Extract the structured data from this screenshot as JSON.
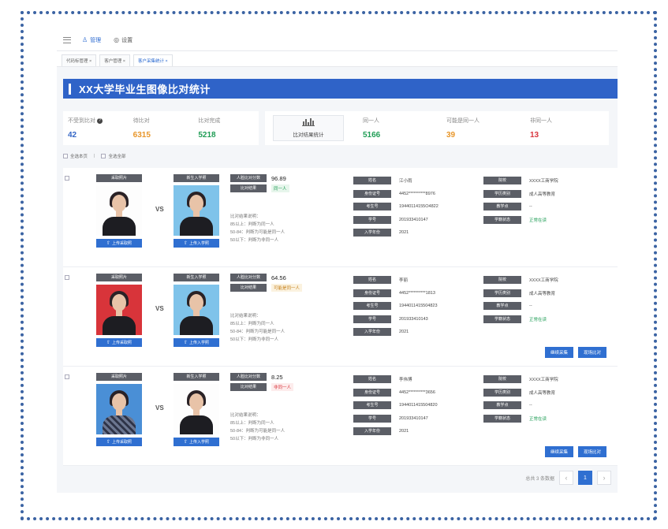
{
  "nav": {
    "items": [
      {
        "icon": "♙",
        "label": "管理",
        "active": true
      },
      {
        "icon": "◎",
        "label": "设置",
        "active": false
      }
    ]
  },
  "tabs": [
    "代码标管理 ×",
    "客户管理 ×",
    "客户采集统计 ×"
  ],
  "page_title": "XX大学毕业生图像比对统计",
  "stats_left": [
    {
      "label": "不受到比对",
      "value": "42",
      "color": "blue",
      "help": true
    },
    {
      "label": "待比对",
      "value": "6315",
      "color": "orange"
    },
    {
      "label": "比对完成",
      "value": "5218",
      "color": "green"
    }
  ],
  "result_button": "比对结果统计",
  "stats_right": [
    {
      "label": "同一人",
      "value": "5166",
      "color": "green"
    },
    {
      "label": "可能是同一人",
      "value": "39",
      "color": "orange"
    },
    {
      "label": "非同一人",
      "value": "13",
      "color": "red"
    }
  ],
  "select_bar": {
    "current_page": "全选本页",
    "all": "全选全部"
  },
  "labels": {
    "collect_photo": "采取照片",
    "enroll_photo": "新生入学照",
    "upload_collect": "上传采取照",
    "upload_enroll": "上传入学照",
    "vs": "VS",
    "score": "人脸比对分数",
    "result": "比对结果",
    "rules_title": "比对结果说明：",
    "rule1": "85以上：判断为同一人",
    "rule2": "50-84：判断为可能是同一人",
    "rule3": "50以下：判断为非同一人",
    "name": "姓名",
    "id_no": "身份证号",
    "exam_no": "考生号",
    "student_no": "学号",
    "year": "入学年份",
    "school": "院校",
    "edu_type": "学历类别",
    "teach_point": "教学点",
    "status": "学籍状态",
    "btn_recollect": "继续采集",
    "btn_compare": "现场比对"
  },
  "records": [
    {
      "score": "96.89",
      "result": "同一人",
      "result_color": "green",
      "name": "江小雨",
      "id_no": "4452**********8976",
      "exam_no": "19440114155O4822",
      "student_no": "201933410147",
      "year": "2021",
      "school": "XXXX工商学院",
      "edu_type": "成人高等教育",
      "teach_point": "--",
      "status": "正常在读",
      "status_color": "green",
      "show_actions": false
    },
    {
      "score": "64.56",
      "result": "可能是同一人",
      "result_color": "orange",
      "name": "李丽",
      "id_no": "4452**********1813",
      "exam_no": "1944011415504823",
      "student_no": "201933410143",
      "year": "2021",
      "school": "XXXX工商学院",
      "edu_type": "成人高等教育",
      "teach_point": "--",
      "status": "正常在读",
      "status_color": "green",
      "show_actions": true
    },
    {
      "score": "8.25",
      "result": "非同一人",
      "result_color": "red",
      "name": "李伟博",
      "id_no": "4452**********3656",
      "exam_no": "1944011415504820",
      "student_no": "201933410147",
      "year": "2021",
      "school": "XXXX工商学院",
      "edu_type": "成人高等教育",
      "teach_point": "--",
      "status": "正常在读",
      "status_color": "green",
      "show_actions": true
    }
  ],
  "pager": {
    "total": "总共 3 条数据",
    "current": "1",
    "prev": "‹",
    "next": "›"
  }
}
